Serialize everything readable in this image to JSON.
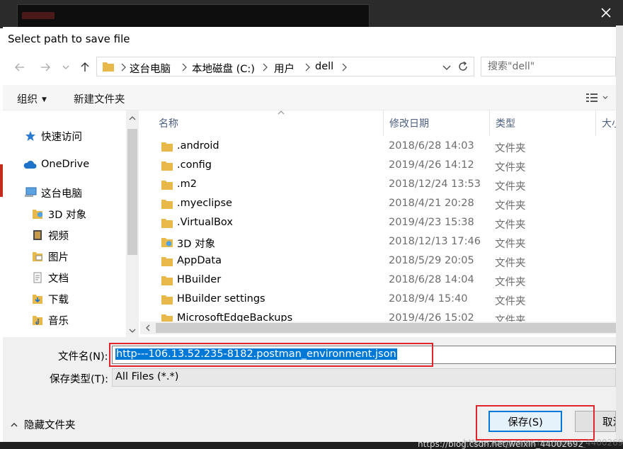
{
  "dialog": {
    "title": "Select path to save file"
  },
  "address": {
    "crumbs": [
      "这台电脑",
      "本地磁盘 (C:)",
      "用户",
      "dell"
    ]
  },
  "search": {
    "placeholder": "搜索\"dell\""
  },
  "toolbar": {
    "organize_label": "组织",
    "new_folder_label": "新建文件夹"
  },
  "nav": {
    "items": [
      {
        "label": "快速访问",
        "icon": "star-icon"
      },
      {
        "label": "OneDrive",
        "icon": "cloud-icon"
      },
      {
        "label": "这台电脑",
        "icon": "computer-icon"
      },
      {
        "label": "3D 对象",
        "icon": "3d-objects-icon"
      },
      {
        "label": "视频",
        "icon": "video-icon"
      },
      {
        "label": "图片",
        "icon": "pictures-icon"
      },
      {
        "label": "文档",
        "icon": "documents-icon"
      },
      {
        "label": "下载",
        "icon": "downloads-icon"
      },
      {
        "label": "音乐",
        "icon": "music-icon"
      }
    ]
  },
  "columns": {
    "name": "名称",
    "date": "修改日期",
    "type": "类型",
    "size": "大小"
  },
  "files": [
    {
      "name": ".android",
      "date": "2018/6/28 14:03",
      "type": "文件夹"
    },
    {
      "name": ".config",
      "date": "2019/4/26 14:12",
      "type": "文件夹"
    },
    {
      "name": ".m2",
      "date": "2018/12/24 13:53",
      "type": "文件夹"
    },
    {
      "name": ".myeclipse",
      "date": "2018/4/21 20:28",
      "type": "文件夹"
    },
    {
      "name": ".VirtualBox",
      "date": "2019/4/23 15:38",
      "type": "文件夹"
    },
    {
      "name": "3D 对象",
      "date": "2018/12/13 17:46",
      "type": "文件夹"
    },
    {
      "name": "AppData",
      "date": "2018/5/29 20:05",
      "type": "文件夹"
    },
    {
      "name": "HBuilder",
      "date": "2018/6/28 14:04",
      "type": "文件夹"
    },
    {
      "name": "HBuilder settings",
      "date": "2018/9/4 15:40",
      "type": "文件夹"
    },
    {
      "name": "MicrosoftEdgeBackups",
      "date": "2019/4/26 15:02",
      "type": "文件夹"
    }
  ],
  "form": {
    "filename_label": "文件名(N):",
    "filename_value": "http---106.13.52.235-8182.postman_environment.json",
    "filetype_label": "保存类型(T):",
    "filetype_value": "All Files (*.*)",
    "hide_folders_label": "隐藏文件夹",
    "save_label": "保存(S)",
    "cancel_label": "取消"
  },
  "watermark": "https://blog.csdn.net/weixin_44002692",
  "colors": {
    "accent": "#0078d7",
    "folder": "#e8b84a",
    "highlight": "#e0242a"
  }
}
